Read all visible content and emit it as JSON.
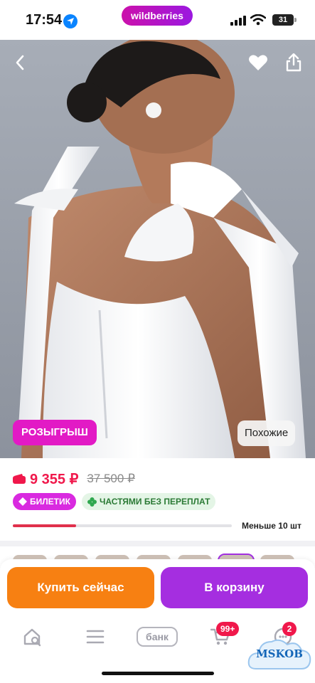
{
  "status_bar": {
    "time": "17:54",
    "battery": "31"
  },
  "brand": {
    "logo_text": "wildberries"
  },
  "hero": {
    "promo_badge": "РОЗЫГРЫШ",
    "similar_button": "Похожие",
    "icons": [
      "chevron-left-icon",
      "heart-icon",
      "share-icon"
    ]
  },
  "product": {
    "price": "9 355 ₽",
    "old_price": "37 500 ₽",
    "tags": {
      "ticket": "БИЛЕТИК",
      "parts": "ЧАСТЯМИ БЕЗ ПЕРЕПЛАТ"
    },
    "stock_text": "Меньше 10 шт",
    "stock_fraction": 0.29
  },
  "actions": {
    "buy_now": "Купить сейчас",
    "to_cart": "В корзину"
  },
  "tabbar": {
    "bank_label": "банк",
    "cart_badge": "99+",
    "profile_badge": "2"
  },
  "watermark": {
    "text": "MSKOB"
  },
  "colors": {
    "accent": "#cb11ab",
    "price": "#f0184b",
    "buy_now": "#f78012",
    "to_cart": "#a52ee0"
  }
}
